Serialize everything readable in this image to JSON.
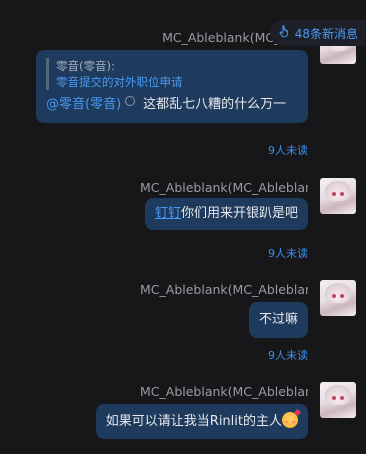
{
  "new_messages": {
    "label": "48条新消息"
  },
  "messages": [
    {
      "name": "MC_Ableblank(MC_Able",
      "quote": {
        "name": "零音(零音):",
        "text": "零音提交的对外职位申请"
      },
      "mention": "@零音(零音)",
      "text": "这都乱七八糟的什么万一",
      "unread": "9人未读"
    },
    {
      "name": "MC_Ableblank(MC_Ableblank)",
      "link": "钉钉",
      "text": "你们用来开银趴是吧",
      "unread": "9人未读"
    },
    {
      "name": "MC_Ableblank(MC_Ableblank)",
      "text": "不过嘛",
      "unread": "9人未读"
    },
    {
      "name": "MC_Ableblank(MC_Ableblank)",
      "text": "如果可以请让我当Rinlit的主人"
    }
  ],
  "colors": {
    "bubble": "#1e3a5c",
    "accent": "#3b8ff0",
    "background": "#17171a"
  },
  "icons": {
    "new_messages": "hand-pointer-icon",
    "emoji": "smiling-face-with-hearts"
  }
}
